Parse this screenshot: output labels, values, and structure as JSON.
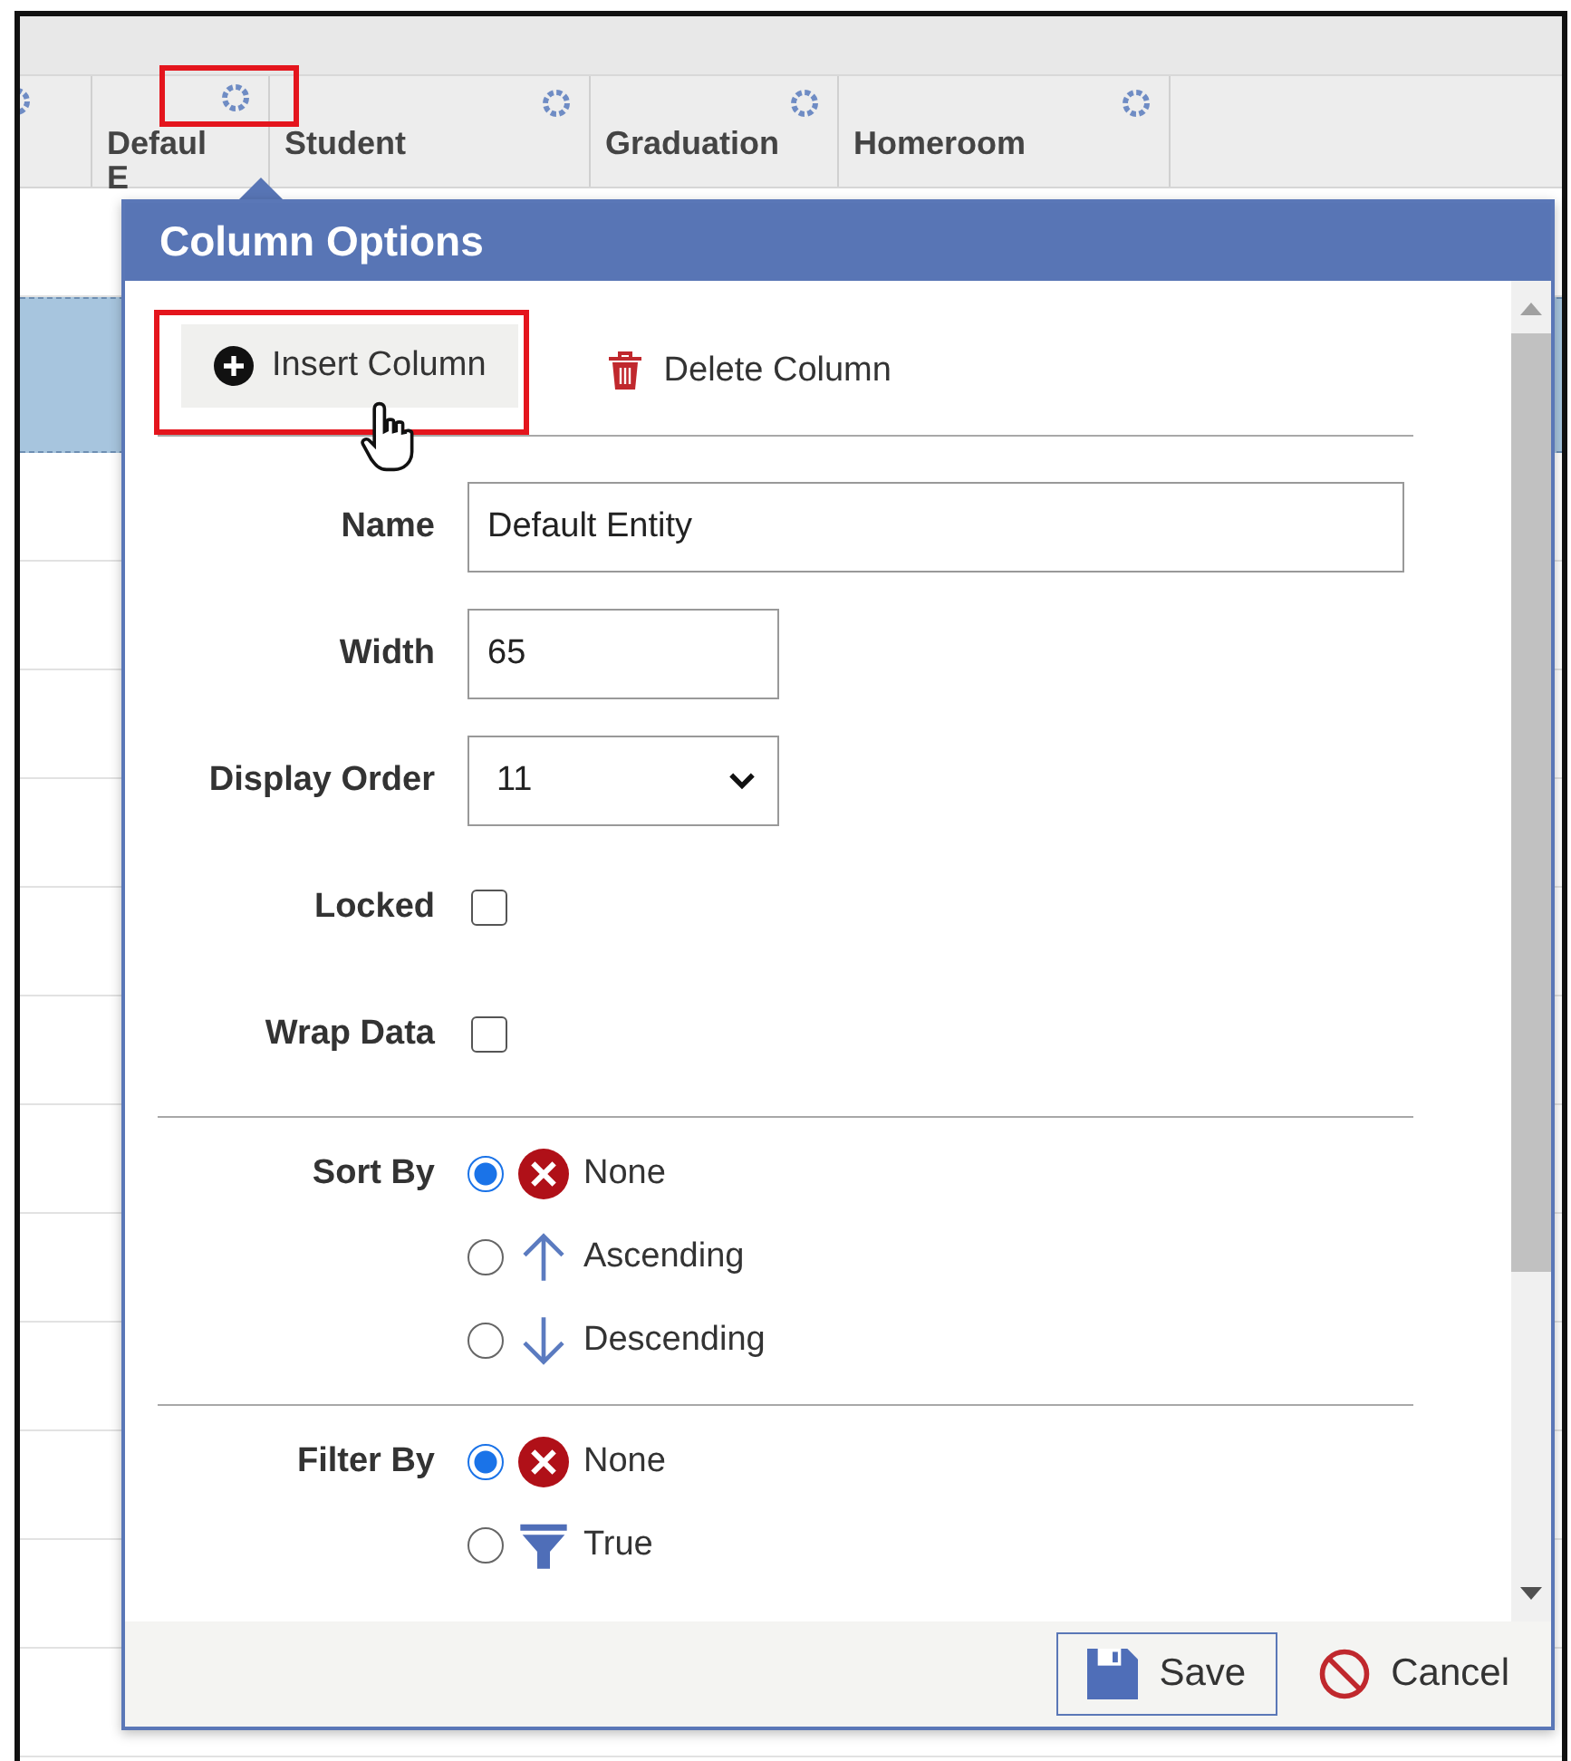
{
  "grid": {
    "columns": [
      {
        "lines": [
          "Defaul",
          "E"
        ],
        "highlighted": true
      },
      {
        "lines": [
          "Student"
        ],
        "highlighted": false
      },
      {
        "lines": [
          "Graduation"
        ],
        "highlighted": false
      },
      {
        "lines": [
          "Homeroom"
        ],
        "highlighted": false
      }
    ]
  },
  "dialog": {
    "title": "Column Options",
    "toolbar": [
      {
        "kind": "insert",
        "label": "Insert Column",
        "highlighted": true
      },
      {
        "kind": "delete",
        "label": "Delete Column",
        "highlighted": false
      }
    ],
    "fields": [
      {
        "kind": "text",
        "label": "Name",
        "value": "Default Entity"
      },
      {
        "kind": "text",
        "label": "Width",
        "value": "65"
      },
      {
        "kind": "select",
        "label": "Display Order",
        "value": "11"
      },
      {
        "kind": "checkbox",
        "label": "Locked",
        "checked": false
      },
      {
        "kind": "checkbox",
        "label": "Wrap Data",
        "checked": false
      }
    ],
    "groups": [
      {
        "label": "Sort By",
        "options": [
          {
            "kind": "none",
            "label": "None",
            "selected": true
          },
          {
            "kind": "ascending",
            "label": "Ascending",
            "selected": false
          },
          {
            "kind": "descending",
            "label": "Descending",
            "selected": false
          }
        ]
      },
      {
        "label": "Filter By",
        "options": [
          {
            "kind": "none",
            "label": "None",
            "selected": true
          },
          {
            "kind": "funnel",
            "label": "True",
            "selected": false
          }
        ]
      }
    ],
    "buttons": [
      {
        "kind": "save",
        "label": "Save"
      },
      {
        "kind": "cancel",
        "label": "Cancel"
      }
    ]
  }
}
